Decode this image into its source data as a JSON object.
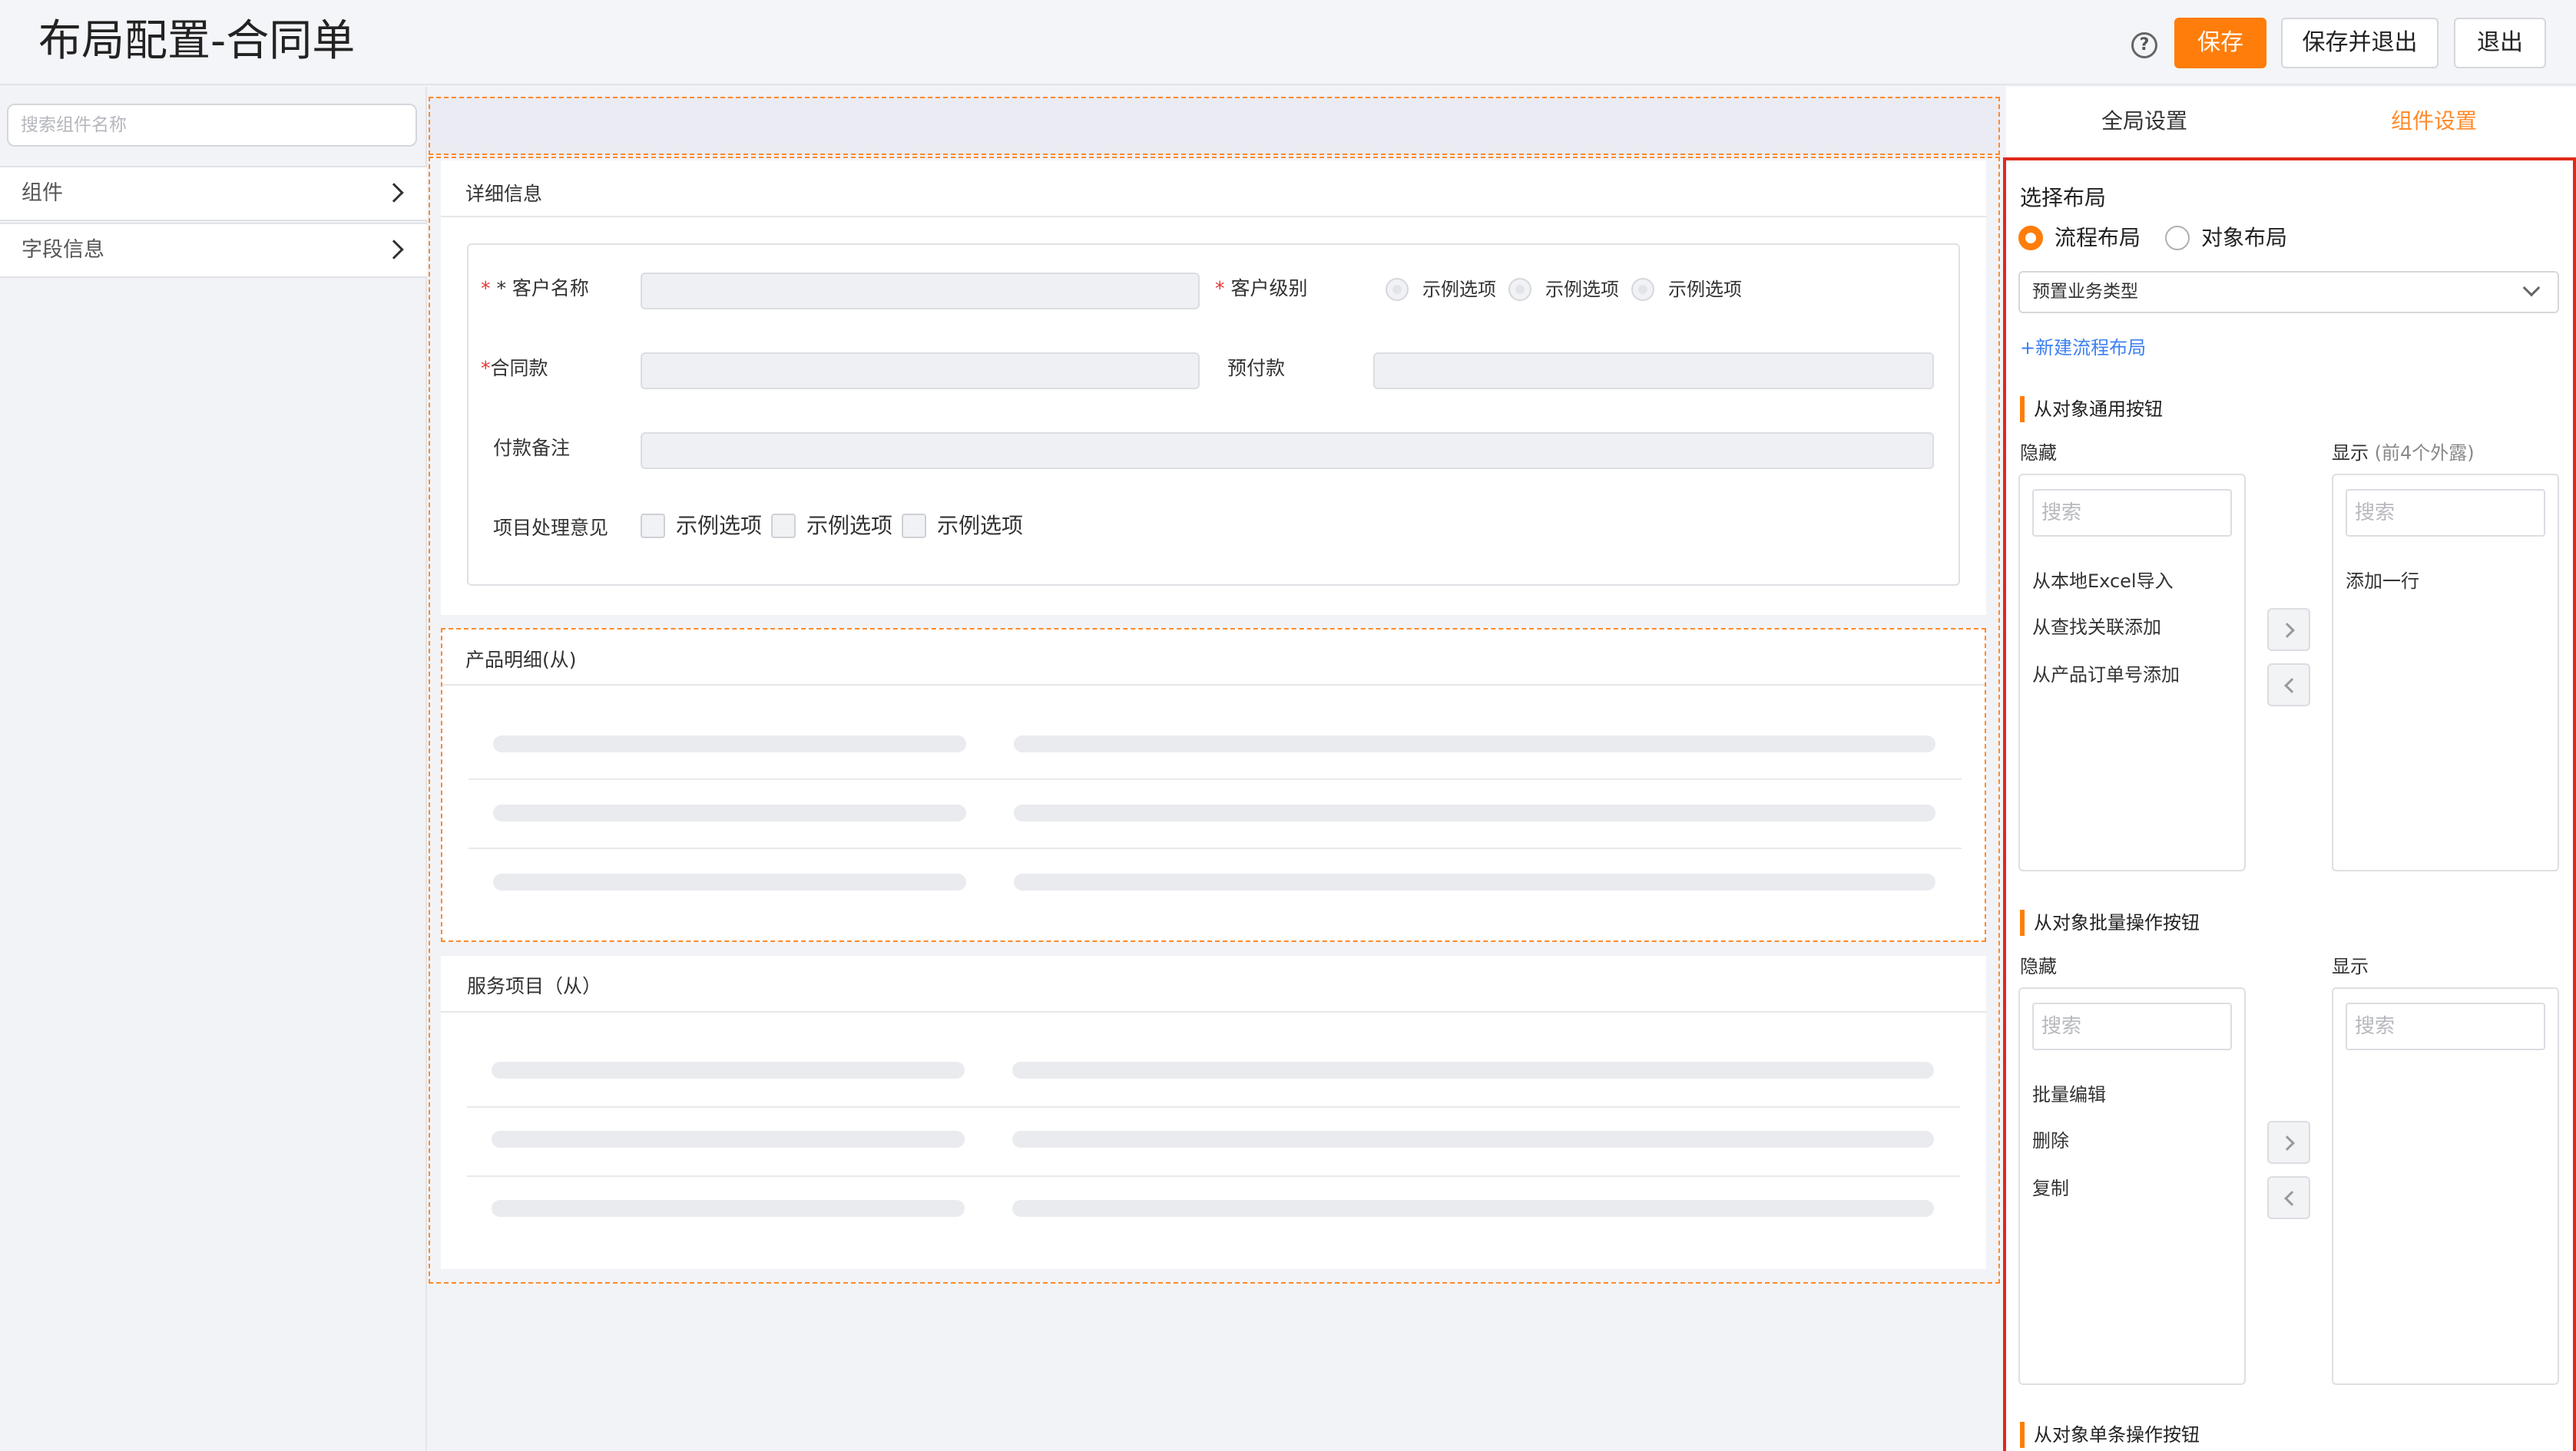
{
  "header": {
    "title": "布局配置-合同单",
    "save": "保存",
    "save_exit": "保存并退出",
    "exit": "退出",
    "help": "?"
  },
  "left": {
    "search_placeholder": "搜索组件名称",
    "items": [
      "组件",
      "字段信息"
    ]
  },
  "detail": {
    "title": "详细信息",
    "customer_name_label": "* 客户名称",
    "customer_level_label": "客户级别",
    "level_options": [
      "示例选项",
      "示例选项",
      "示例选项"
    ],
    "contract_label": "合同款",
    "prepay_label": "预付款",
    "remark_label": "付款备注",
    "opinion_label": "项目处理意见",
    "opinion_options": [
      "示例选项",
      "示例选项",
      "示例选项"
    ],
    "req": "*"
  },
  "products": {
    "title": "产品明细(从)"
  },
  "services": {
    "title": "服务项目（从）"
  },
  "right": {
    "tabs": [
      "全局设置",
      "组件设置"
    ],
    "choose_layout": "选择布局",
    "layout_options": [
      "流程布局",
      "对象布局"
    ],
    "business_type": "预置业务类型",
    "new_layout_link": "+新建流程布局",
    "groups": [
      {
        "title": "从对象通用按钮",
        "hidden_label": "隐藏",
        "shown_label": "显示",
        "shown_note": "(前4个外露)",
        "search": "搜索",
        "hidden_items": [
          "从本地Excel导入",
          "从查找关联添加",
          "从产品订单号添加"
        ],
        "shown_items": [
          "添加一行"
        ]
      },
      {
        "title": "从对象批量操作按钮",
        "hidden_label": "隐藏",
        "shown_label": "显示",
        "search": "搜索",
        "hidden_items": [
          "批量编辑",
          "删除",
          "复制"
        ],
        "shown_items": []
      },
      {
        "title": "从对象单条操作按钮"
      }
    ]
  }
}
